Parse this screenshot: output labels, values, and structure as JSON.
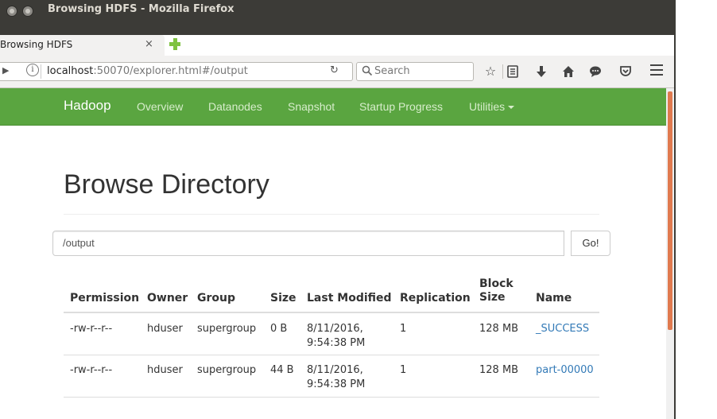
{
  "window": {
    "title": "Browsing HDFS - Mozilla Firefox"
  },
  "tab": {
    "label": "Browsing HDFS",
    "close": "×"
  },
  "navbar": {
    "url_host": "localhost",
    "url_rest": ":50070/explorer.html#/output",
    "search_placeholder": "Search",
    "icons": [
      "info-icon",
      "reload-icon",
      "search-icon",
      "bookmark-star-icon",
      "reading-list-icon",
      "download-icon",
      "home-icon",
      "chat-icon",
      "pocket-icon",
      "menu-icon"
    ]
  },
  "hadoop_nav": {
    "brand": "Hadoop",
    "links": [
      "Overview",
      "Datanodes",
      "Snapshot",
      "Startup Progress",
      "Utilities"
    ]
  },
  "page": {
    "title": "Browse Directory",
    "dir_value": "/output",
    "go_label": "Go!"
  },
  "table": {
    "headers": {
      "permission": "Permission",
      "owner": "Owner",
      "group": "Group",
      "size": "Size",
      "last_modified": "Last Modified",
      "replication": "Replication",
      "block_size_1": "Block",
      "block_size_2": "Size",
      "name": "Name"
    },
    "rows": [
      {
        "permission": "-rw-r--r--",
        "owner": "hduser",
        "group": "supergroup",
        "size": "0 B",
        "date": "8/11/2016,",
        "time": "9:54:38 PM",
        "replication": "1",
        "block_size": "128 MB",
        "name": "_SUCCESS"
      },
      {
        "permission": "-rw-r--r--",
        "owner": "hduser",
        "group": "supergroup",
        "size": "44 B",
        "date": "8/11/2016,",
        "time": "9:54:38 PM",
        "replication": "1",
        "block_size": "128 MB",
        "name": "part-00000"
      }
    ]
  },
  "colors": {
    "hadoop_green": "#5aa540",
    "link_blue": "#337ab7",
    "titlebar": "#3c3b37",
    "scroll_thumb": "#e07a4f"
  }
}
